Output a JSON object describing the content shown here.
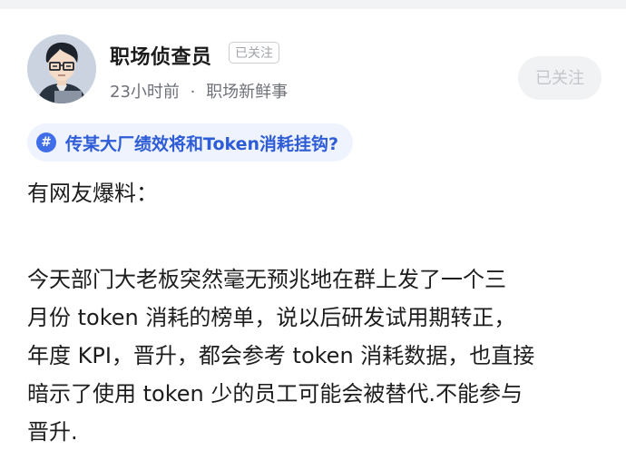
{
  "author": {
    "name": "职场侦查员",
    "badge": "已关注",
    "time": "23小时前",
    "separator": "·",
    "section": "职场新鲜事"
  },
  "follow_button": {
    "label": "已关注"
  },
  "topic": {
    "icon": "#",
    "text": "传某大厂绩效将和Token消耗挂钩?"
  },
  "post": {
    "intro": "有网友爆料：",
    "lines": [
      "今天部门大老板突然毫无预兆地在群上发了一个三",
      "月份 token 消耗的榜单，说以后研发试用期转正，",
      "年度 KPI，晋升，都会参考 token 消耗数据，也直接",
      "暗示了使用 token 少的员工可能会被替代.不能参与",
      "晋升."
    ]
  },
  "colors": {
    "accent": "#2e5cd6",
    "topic_bg": "#eef3fd",
    "follow_bg": "#f1f2f4",
    "meta_text": "#6e7178"
  }
}
